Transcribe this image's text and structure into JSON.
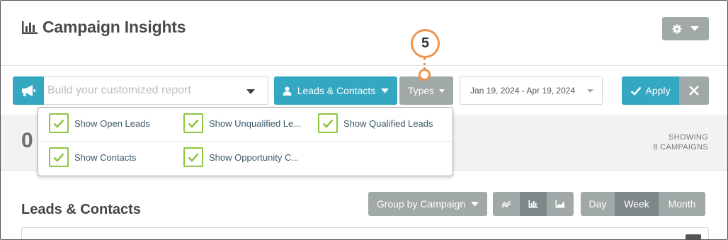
{
  "header": {
    "title": "Campaign Insights",
    "title_icon": "bar-chart-icon",
    "settings_icon": "gear-icon"
  },
  "toolbar": {
    "report_placeholder": "Build your customized report",
    "report_icon": "megaphone-icon",
    "leads_contacts_label": "Leads & Contacts",
    "types_label": "Types",
    "date_range": "Jan 19, 2024 - Apr 19, 2024",
    "apply_label": "Apply"
  },
  "callout": {
    "number": "5"
  },
  "types_menu": {
    "options": [
      {
        "label": "Show Open Leads",
        "checked": true
      },
      {
        "label": "Show Unqualified Le...",
        "checked": true
      },
      {
        "label": "Show Qualified Leads",
        "checked": true
      },
      {
        "label": "Show Contacts",
        "checked": true
      },
      {
        "label": "Show Opportunity C...",
        "checked": true
      }
    ]
  },
  "summary": {
    "big_number": "0",
    "showing_line1": "SHOWING",
    "showing_line2": "8 CAMPAIGNS"
  },
  "section": {
    "title": "Leads & Contacts",
    "group_by_label": "Group by Campaign",
    "chart_types": [
      "line-chart-icon",
      "bar-chart-icon",
      "area-chart-icon"
    ],
    "active_chart_type": "bar-chart-icon",
    "periods": [
      "Day",
      "Week",
      "Month"
    ],
    "active_period": "Week"
  },
  "colors": {
    "accent": "#35a8c1",
    "neutral_button": "#a0a8a8",
    "active_segment": "#7f8888",
    "check": "#8dc63f",
    "callout": "#f0944d"
  }
}
